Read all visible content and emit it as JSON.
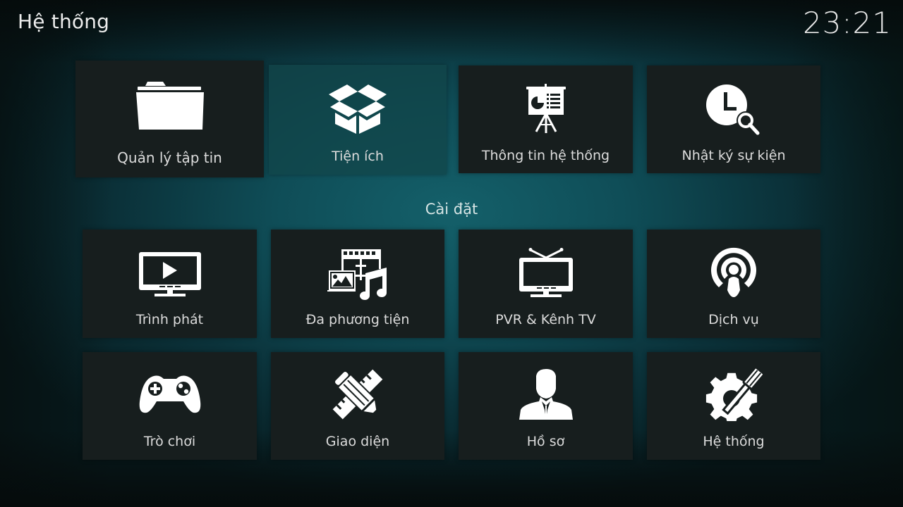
{
  "header": {
    "title": "Hệ thống",
    "clock": "23:21"
  },
  "top_tiles": [
    {
      "label": "Quản lý tập tin",
      "icon": "folder-icon",
      "focused": true
    },
    {
      "label": "Tiện ích",
      "icon": "open-box-icon",
      "focused": false
    },
    {
      "label": "Thông tin hệ thống",
      "icon": "presentation-board-icon",
      "focused": false
    },
    {
      "label": "Nhật ký sự kiện",
      "icon": "clock-search-icon",
      "focused": false
    }
  ],
  "settings_section": {
    "title": "Cài đặt",
    "tiles": [
      {
        "label": "Trình phát",
        "icon": "monitor-play-icon"
      },
      {
        "label": "Đa phương tiện",
        "icon": "media-library-icon"
      },
      {
        "label": "PVR & Kênh TV",
        "icon": "tv-antenna-icon"
      },
      {
        "label": "Dịch vụ",
        "icon": "broadcast-person-icon"
      },
      {
        "label": "Trò chơi",
        "icon": "gamepad-icon"
      },
      {
        "label": "Giao diện",
        "icon": "pencil-ruler-icon"
      },
      {
        "label": "Hồ sơ",
        "icon": "user-profile-icon"
      },
      {
        "label": "Hệ thống",
        "icon": "gear-screwdriver-icon"
      }
    ]
  },
  "colors": {
    "tile_bg": "#171e1e",
    "background_accent": "#14606a",
    "text": "#e6e6e6"
  }
}
